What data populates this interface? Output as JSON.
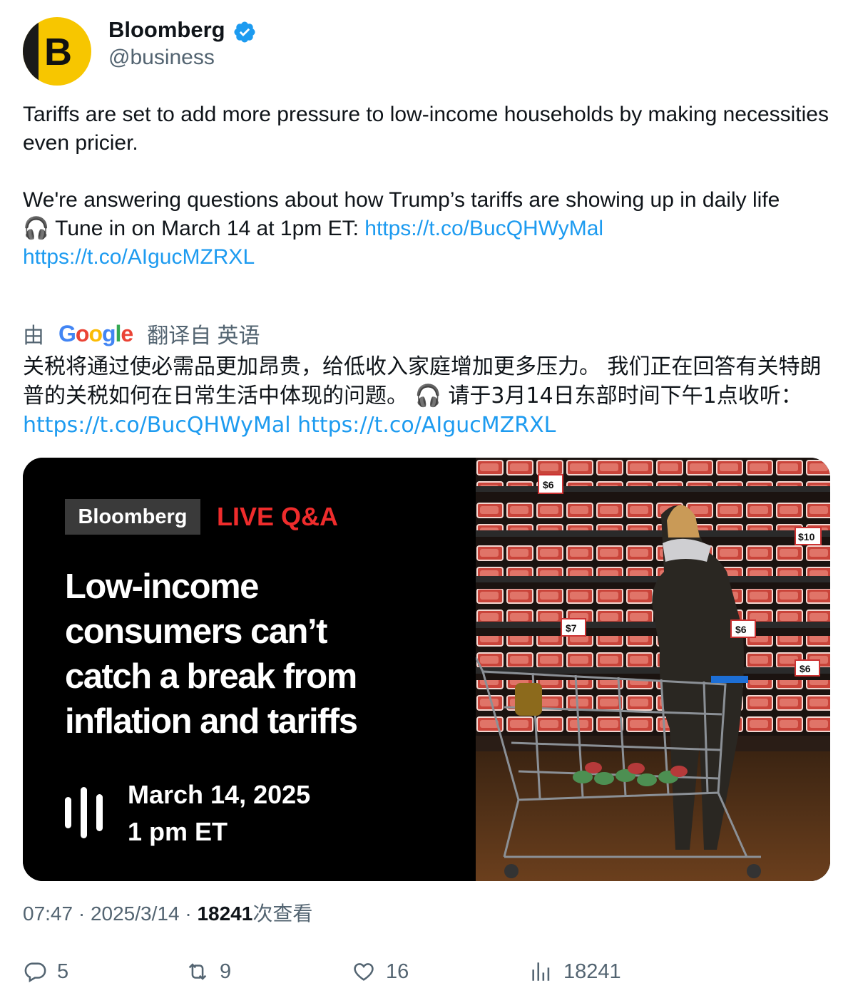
{
  "author": {
    "name": "Bloomberg",
    "handle": "@business",
    "avatar_letter": "B",
    "verified_color": "#1d9bf0"
  },
  "tweet": {
    "line1": "Tariffs are set to add more pressure to low-income households by making necessities even pricier.",
    "line2": "We're answering questions about how Trump’s tariffs are showing up in daily life",
    "line3_emoji": "🎧",
    "line3_text": " Tune in on March 14 at 1pm ET: ",
    "link1": "https://t.co/BucQHWyMal",
    "link2": "https://t.co/AIgucMZRXL"
  },
  "translation": {
    "prefix": "由",
    "provider": "Google",
    "suffix": "翻译自 英语",
    "text": "关税将通过使必需品更加昂贵，给低收入家庭增加更多压力。 我们正在回答有关特朗普的关税如何在日常生活中体现的问题。 🎧 请于3月14日东部时间下午1点收听：",
    "link1": "https://t.co/BucQHWyMal",
    "link2": "https://t.co/AIgucMZRXL"
  },
  "card": {
    "logo": "Bloomberg",
    "tag": "LIVE Q&A",
    "headline_lines": [
      "Low-income",
      "consumers can’t",
      "catch a break from",
      "inflation and tariffs"
    ],
    "date": "March 14, 2025",
    "time": "1 pm ET",
    "photo_price_tags": [
      "$6",
      "$10",
      "$7",
      "$6",
      "$6"
    ]
  },
  "meta": {
    "time": "07:47",
    "separator": " · ",
    "date": "2025/3/14",
    "views": "18241",
    "views_label": "次查看"
  },
  "actions": {
    "replies": "5",
    "retweets": "9",
    "likes": "16",
    "views": "18241"
  }
}
